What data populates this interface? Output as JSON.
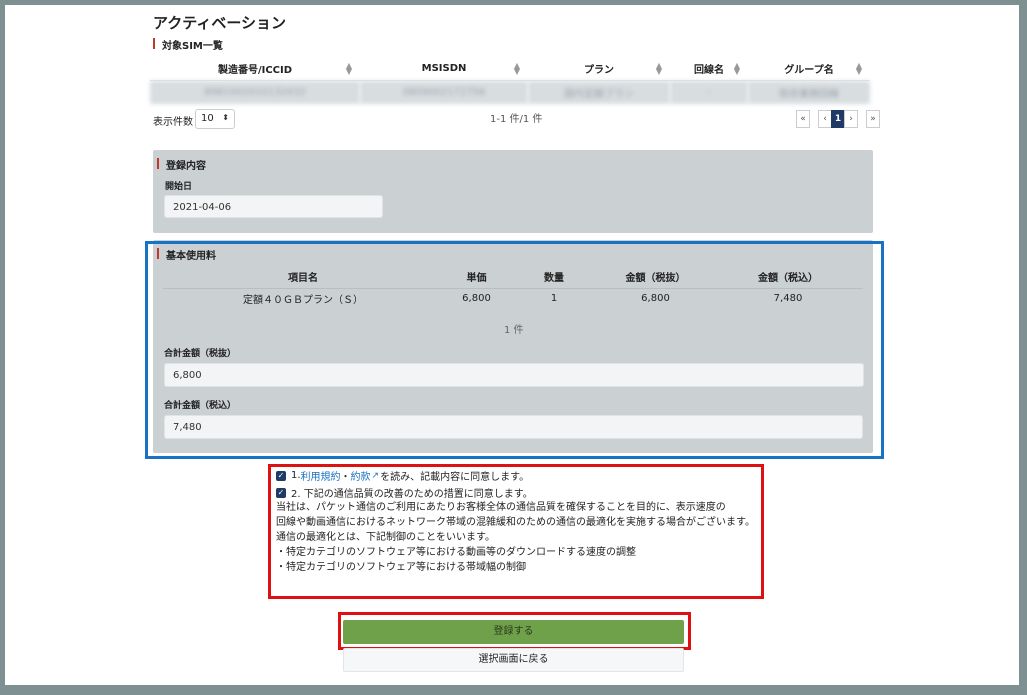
{
  "page": {
    "title": "アクティベーション"
  },
  "sim_list": {
    "section_title": "対象SIM一覧",
    "columns": [
      "製造番号/ICCID",
      "MSISDN",
      "プラン",
      "回線名",
      "グループ名"
    ],
    "rows": [
      [
        "8981002010132432",
        "0809002172756",
        "国内定額プラン",
        "-",
        "既存業務回線"
      ]
    ],
    "per_page_label": "表示件数",
    "per_page_value": "10",
    "count_text": "1-1 件/1 件",
    "pager": [
      "«",
      "‹",
      "1",
      "›",
      "»"
    ]
  },
  "registration": {
    "section_title": "登録内容",
    "start_date_label": "開始日",
    "start_date_value": "2021-04-06"
  },
  "basic_fee": {
    "section_title": "基本使用料",
    "columns": [
      "項目名",
      "単価",
      "数量",
      "金額（税抜）",
      "金額（税込）"
    ],
    "rows": [
      [
        "定額４０ＧＢプラン（Ｓ）",
        "6,800",
        "1",
        "6,800",
        "7,480"
      ]
    ],
    "count_text": "1 件",
    "total_ex_tax_label": "合計金額（税抜）",
    "total_ex_tax_value": "6,800",
    "total_in_tax_label": "合計金額（税込）",
    "total_in_tax_value": "7,480"
  },
  "agreement": {
    "item1_prefix": "1. ",
    "item1_link1": "利用規約",
    "item1_sep": "・",
    "item1_link2": "約款",
    "item1_suffix": "を読み、記載内容に同意します。",
    "item2": "2. 下記の通信品質の改善のための措置に同意します。",
    "notice_lines": [
      "当社は、パケット通信のご利用にあたりお客様全体の通信品質を確保することを目的に、表示速度の",
      "回線や動画通信におけるネットワーク帯域の混雑緩和のための通信の最適化を実施する場合がございます。",
      "通信の最適化とは、下記制御のことをいいます。",
      "・特定カテゴリのソフトウェア等における動画等のダウンロードする速度の調整",
      "・特定カテゴリのソフトウェア等における帯域幅の制御"
    ]
  },
  "actions": {
    "register_label": "登録する",
    "back_label": "選択画面に戻る"
  },
  "colors": {
    "register_button": "#6fa04a",
    "highlight_blue": "#1a72c4",
    "highlight_red": "#dd1111",
    "panel": "#cbd0d3"
  }
}
